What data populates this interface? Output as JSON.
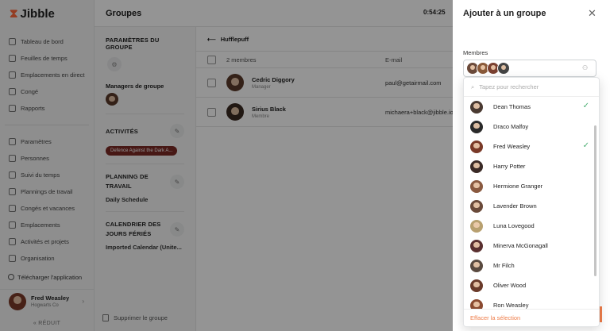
{
  "colors": {
    "brand": "#ff6a3d",
    "check": "#4caf74",
    "chip": "#7a2a25",
    "clear": "#ef7d4a"
  },
  "logo": {
    "text": "Jibble"
  },
  "sidebar": {
    "top_items": [
      {
        "label": "Tableau de bord",
        "icon": "dashboard-icon"
      },
      {
        "label": "Feuilles de temps",
        "icon": "clock-icon"
      },
      {
        "label": "Emplacements en direct",
        "icon": "location-icon"
      },
      {
        "label": "Congé",
        "icon": "briefcase-icon"
      },
      {
        "label": "Rapports",
        "icon": "report-icon"
      }
    ],
    "bottom_items": [
      {
        "label": "Paramètres",
        "icon": "chevron-up-icon"
      },
      {
        "label": "Personnes",
        "icon": "people-icon"
      },
      {
        "label": "Suivi du temps",
        "icon": "time-tracking-icon"
      },
      {
        "label": "Plannings de travail",
        "icon": "schedule-icon"
      },
      {
        "label": "Congés et vacances",
        "icon": "vacation-icon"
      },
      {
        "label": "Emplacements",
        "icon": "location-icon"
      },
      {
        "label": "Activités et projets",
        "icon": "tag-icon"
      },
      {
        "label": "Organisation",
        "icon": "gear-icon"
      }
    ],
    "download": "Télécharger l'application",
    "user": {
      "name": "Fred Weasley",
      "org": "Hogwarts Co"
    },
    "collapse": "RÉDUIT"
  },
  "header": {
    "title": "Groupes",
    "timer": "0:54:25"
  },
  "group_settings": {
    "title": "PARAMÈTRES DU GROUPE",
    "managers_title": "Managers de groupe",
    "activities_title": "ACTIVITÉS",
    "activity_chip": "Defence Against the Dark A...",
    "planning_title": "PLANNING DE TRAVAIL",
    "planning_value": "Daily Schedule",
    "holidays_title": "CALENDRIER DES JOURS FÉRIÉS",
    "holidays_value": "Imported Calendar (Unite...",
    "delete_group": "Supprimer le groupe"
  },
  "group": {
    "name": "Hufflepuff",
    "header_members": "2 membres",
    "header_email": "E-mail",
    "members": [
      {
        "name": "Cedric Diggory",
        "role": "Manager",
        "email": "paul@getairmail.com",
        "color": "#5a3a2a"
      },
      {
        "name": "Sirius Black",
        "role": "Membre",
        "email": "michaera+black@jibble.io",
        "color": "#3a2a22"
      }
    ]
  },
  "panel": {
    "title": "Ajouter à un groupe",
    "members_label": "Membres",
    "selected_avatars": [
      "#6b4a3a",
      "#8a5a3a",
      "#7a4030",
      "#444444"
    ],
    "search_placeholder": "Tapez pour rechercher",
    "options": [
      {
        "name": "Dean Thomas",
        "selected": true,
        "color": "#4a3a32"
      },
      {
        "name": "Draco Malfoy",
        "selected": false,
        "color": "#2a2a2a"
      },
      {
        "name": "Fred Weasley",
        "selected": true,
        "color": "#7a3a28"
      },
      {
        "name": "Harry Potter",
        "selected": false,
        "color": "#3a2a26"
      },
      {
        "name": "Hermione Granger",
        "selected": false,
        "color": "#8a5a40"
      },
      {
        "name": "Lavender Brown",
        "selected": false,
        "color": "#6a4a3a"
      },
      {
        "name": "Luna Lovegood",
        "selected": false,
        "color": "#b8a070"
      },
      {
        "name": "Minerva McGonagall",
        "selected": false,
        "color": "#5a3030"
      },
      {
        "name": "Mr Filch",
        "selected": false,
        "color": "#5a4a40"
      },
      {
        "name": "Oliver Wood",
        "selected": false,
        "color": "#6a3a2a"
      },
      {
        "name": "Ron Weasley",
        "selected": false,
        "color": "#8a4a30"
      }
    ],
    "check_glyph": "✓",
    "clear": "Effacer la sélection"
  }
}
